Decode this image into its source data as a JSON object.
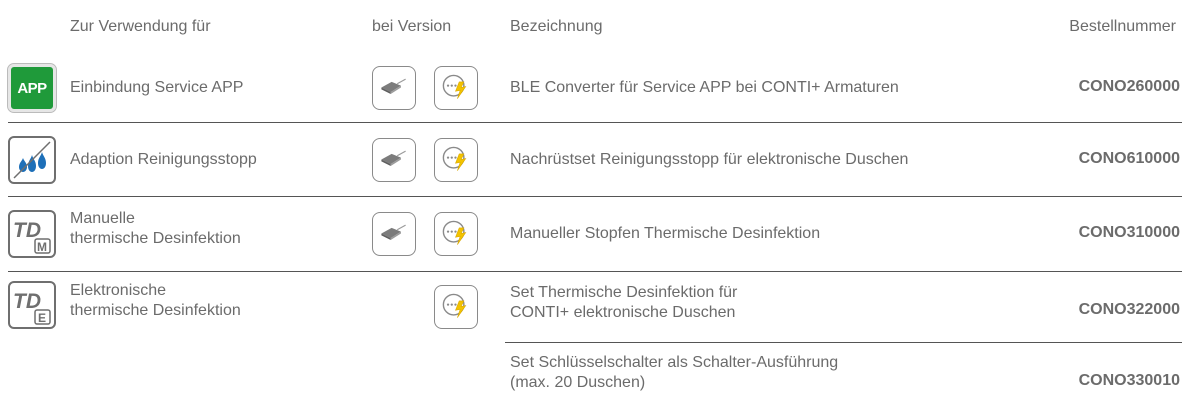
{
  "header": {
    "use": "Zur Verwendung für",
    "version": "bei Version",
    "description": "Bezeichnung",
    "order_number": "Bestellnummer"
  },
  "colors": {
    "app_green": "#1f9a3a",
    "drop_blue": "#1d6fb8",
    "bolt_yellow": "#f3c300",
    "text": "#6b6b6b"
  },
  "rows": [
    {
      "feature_icon": "app-icon",
      "feature_icon_text": "APP",
      "use_line1": "Einbindung Service APP",
      "versions": [
        "sensor-icon",
        "power-bolt-icon"
      ],
      "desc_line1": "BLE Converter für Service APP bei CONTI+ Armaturen",
      "order": "CONO260000"
    },
    {
      "feature_icon": "water-drops-icon",
      "use_line1": "Adaption Reinigungsstopp",
      "versions": [
        "sensor-icon",
        "power-bolt-icon"
      ],
      "desc_line1": "Nachrüstset Reinigungsstopp für elektronische Duschen",
      "order": "CONO610000"
    },
    {
      "feature_icon": "td-manual-icon",
      "use_line1": "Manuelle",
      "use_line2": "thermische Desinfektion",
      "versions": [
        "sensor-icon",
        "power-bolt-icon"
      ],
      "desc_line1": "Manueller Stopfen Thermische Desinfektion",
      "order": "CONO310000"
    },
    {
      "feature_icon": "td-electronic-icon",
      "use_line1": "Elektronische",
      "use_line2": "thermische Desinfektion",
      "versions": [
        "power-bolt-icon"
      ],
      "desc_line1": "Set Thermische Desinfektion für",
      "desc_line2": "CONTI+ elektronische Duschen",
      "order": "CONO322000"
    },
    {
      "desc_line1": "Set Schlüsselschalter als Schalter-Ausführung",
      "desc_line2": "(max. 20 Duschen)",
      "order": "CONO330010"
    }
  ]
}
